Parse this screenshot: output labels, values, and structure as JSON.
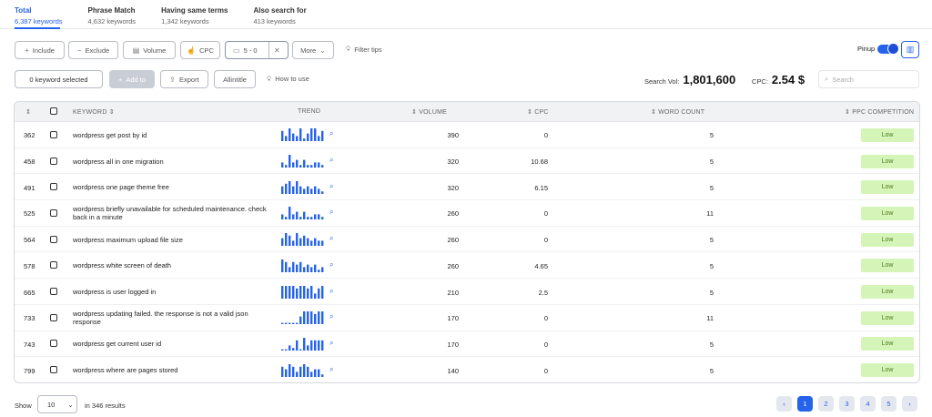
{
  "tabs": [
    {
      "title": "Total",
      "count": "6,387 keywords"
    },
    {
      "title": "Phrase Match",
      "count": "4,632 keywords"
    },
    {
      "title": "Having same terms",
      "count": "1,342 keywords"
    },
    {
      "title": "Also search for",
      "count": "413 keywords"
    }
  ],
  "toolbar": {
    "include": "Include",
    "exclude": "Exclude",
    "volume": "Volume",
    "cpc": "CPC",
    "range": "5 - 0",
    "more": "More",
    "filter_tips": "Filter tips",
    "pinup": "Pinup"
  },
  "actions": {
    "selected": "0 keyword selected",
    "add_to": "Add to",
    "export": "Export",
    "allintitle": "Allintitle",
    "how_to_use": "How to use"
  },
  "stats": {
    "search_vol_label": "Search Vol:",
    "search_vol": "1,801,600",
    "cpc_label": "CPC:",
    "cpc": "2.54 $"
  },
  "search": {
    "placeholder": "Search"
  },
  "table": {
    "headers": {
      "keyword": "KEYWORD",
      "trend": "TREND",
      "volume": "VOLUME",
      "cpc": "CPC",
      "word_count": "WORD COUNT",
      "ppc": "PPC COMPETITION"
    },
    "rows": [
      {
        "rank": "362",
        "keyword": "wordpress get post by id",
        "volume": "390",
        "cpc": "0",
        "words": "5",
        "ppc": "Low",
        "trend": [
          8,
          4,
          10,
          6,
          4,
          10,
          2,
          6,
          10,
          10,
          4,
          8
        ]
      },
      {
        "rank": "458",
        "keyword": "wordpress all in one migration",
        "volume": "320",
        "cpc": "10.68",
        "words": "5",
        "ppc": "Low",
        "trend": [
          4,
          2,
          10,
          4,
          6,
          2,
          6,
          2,
          2,
          4,
          4,
          2
        ]
      },
      {
        "rank": "491",
        "keyword": "wordpress one page theme free",
        "volume": "320",
        "cpc": "6.15",
        "words": "5",
        "ppc": "Low",
        "trend": [
          6,
          8,
          10,
          6,
          10,
          6,
          4,
          6,
          4,
          6,
          4,
          2
        ]
      },
      {
        "rank": "525",
        "keyword": "wordpress briefly unavailable for scheduled maintenance. check back in a minute",
        "volume": "260",
        "cpc": "0",
        "words": "11",
        "ppc": "Low",
        "trend": [
          4,
          2,
          10,
          4,
          6,
          2,
          6,
          2,
          2,
          4,
          4,
          2
        ]
      },
      {
        "rank": "564",
        "keyword": "wordpress maximum upload file size",
        "volume": "260",
        "cpc": "0",
        "words": "5",
        "ppc": "Low",
        "trend": [
          6,
          10,
          8,
          4,
          10,
          6,
          8,
          6,
          4,
          6,
          4,
          4
        ]
      },
      {
        "rank": "578",
        "keyword": "wordpress white screen of death",
        "volume": "260",
        "cpc": "4.65",
        "words": "5",
        "ppc": "Low",
        "trend": [
          10,
          8,
          4,
          8,
          6,
          8,
          4,
          6,
          4,
          6,
          2,
          4
        ]
      },
      {
        "rank": "665",
        "keyword": "wordpress is user logged in",
        "volume": "210",
        "cpc": "2.5",
        "words": "5",
        "ppc": "Low",
        "trend": [
          10,
          10,
          10,
          10,
          8,
          10,
          10,
          8,
          10,
          4,
          8,
          10
        ]
      },
      {
        "rank": "733",
        "keyword": "wordpress updating failed. the response is not a valid json response",
        "volume": "170",
        "cpc": "0",
        "words": "11",
        "ppc": "Low",
        "trend": [
          1,
          1,
          1,
          1,
          1,
          6,
          10,
          10,
          10,
          8,
          10,
          10
        ]
      },
      {
        "rank": "743",
        "keyword": "wordpress get current user id",
        "volume": "170",
        "cpc": "0",
        "words": "5",
        "ppc": "Low",
        "trend": [
          1,
          1,
          4,
          2,
          8,
          1,
          10,
          4,
          8,
          8,
          8,
          8
        ]
      },
      {
        "rank": "799",
        "keyword": "wordpress where are pages stored",
        "volume": "140",
        "cpc": "0",
        "words": "5",
        "ppc": "Low",
        "trend": [
          8,
          6,
          10,
          8,
          4,
          8,
          10,
          8,
          4,
          6,
          6,
          2
        ]
      }
    ]
  },
  "footer": {
    "show": "Show",
    "per_page": "10",
    "results": "in 346 results",
    "pages": [
      "1",
      "2",
      "3",
      "4",
      "5"
    ],
    "prev": "‹",
    "next": "›"
  },
  "colors": {
    "accent": "#2563eb",
    "low_badge": "#d5f5b8"
  }
}
